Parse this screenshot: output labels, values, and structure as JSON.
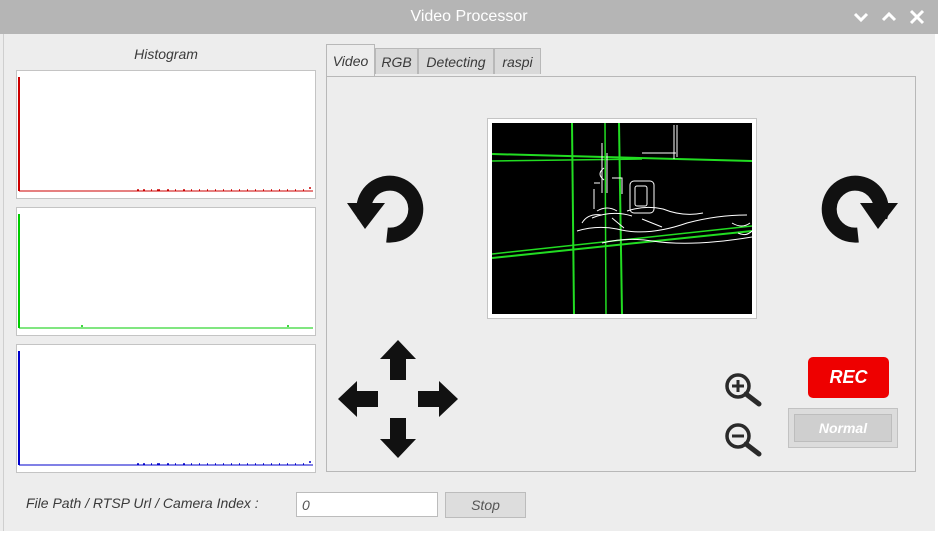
{
  "window": {
    "title": "Video Processor",
    "controls": [
      "chevron-down-icon",
      "chevron-up-icon",
      "close-icon"
    ]
  },
  "histogram": {
    "label": "Histogram",
    "channels": [
      {
        "name": "red",
        "color": "#cc0000"
      },
      {
        "name": "green",
        "color": "#00cc00"
      },
      {
        "name": "blue",
        "color": "#0000cc"
      }
    ]
  },
  "tabs": [
    {
      "label": "Video",
      "active": true
    },
    {
      "label": "RGB",
      "active": false
    },
    {
      "label": "Detecting",
      "active": false
    },
    {
      "label": "raspi",
      "active": false
    }
  ],
  "controls": {
    "rotate_left_icon": "rotate-left-icon",
    "rotate_right_icon": "rotate-right-icon",
    "move_icons": [
      "arrow-up-icon",
      "arrow-left-icon",
      "arrow-right-icon",
      "arrow-down-icon"
    ],
    "zoom_in_icon": "zoom-in-icon",
    "zoom_out_icon": "zoom-out-icon",
    "rec_label": "REC",
    "rec_color": "#ee0000",
    "mode_label": "Normal"
  },
  "source": {
    "label": "File Path / RTSP Url / Camera Index :",
    "value": "0",
    "button_label": "Stop"
  }
}
